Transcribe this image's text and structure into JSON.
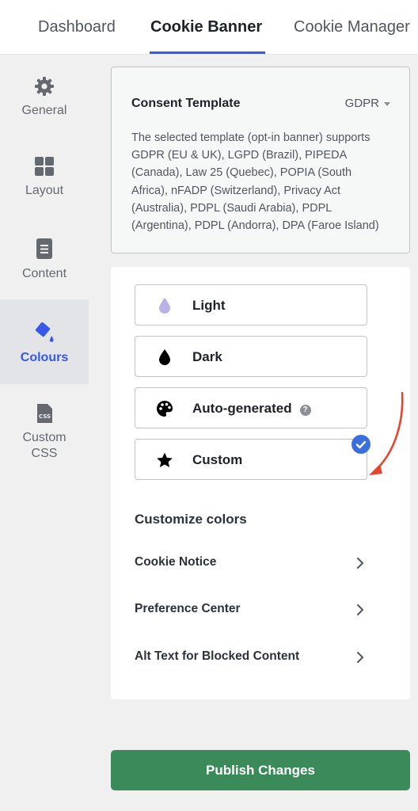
{
  "tabs": [
    {
      "label": "Dashboard",
      "active": false
    },
    {
      "label": "Cookie Banner",
      "active": true
    },
    {
      "label": "Cookie Manager",
      "active": false
    }
  ],
  "sidebar": {
    "items": [
      {
        "label": "General",
        "icon": "gear-icon",
        "active": false
      },
      {
        "label": "Layout",
        "icon": "grid-icon",
        "active": false
      },
      {
        "label": "Content",
        "icon": "document-icon",
        "active": false
      },
      {
        "label": "Colours",
        "icon": "paint-bucket-icon",
        "active": true
      },
      {
        "label": "Custom CSS",
        "icon": "css-file-icon",
        "active": false
      }
    ]
  },
  "consent_template": {
    "title": "Consent Template",
    "selected": "GDPR",
    "description": "The selected template (opt-in banner) supports GDPR (EU & UK), LGPD (Brazil), PIPEDA (Canada), Law 25 (Quebec), POPIA (South Africa), nFADP (Switzerland), Privacy Act (Australia), PDPL (Saudi Arabia), PDPL (Argentina), PDPL (Andorra), DPA (Faroe Island)"
  },
  "colour_options": [
    {
      "label": "Light",
      "icon": "drop-light-icon",
      "selected": false
    },
    {
      "label": "Dark",
      "icon": "drop-dark-icon",
      "selected": false
    },
    {
      "label": "Auto-generated",
      "icon": "palette-icon",
      "selected": false,
      "has_help": true
    },
    {
      "label": "Custom",
      "icon": "star-icon",
      "selected": true
    }
  ],
  "customize": {
    "title": "Customize colors",
    "rows": [
      {
        "label": "Cookie Notice"
      },
      {
        "label": "Preference Center"
      },
      {
        "label": "Alt Text for Blocked Content"
      }
    ]
  },
  "publish_label": "Publish Changes",
  "colors": {
    "accent": "#3858e9",
    "publish": "#3a8a5a",
    "annotation_arrow": "#e8442e",
    "check_badge": "#3b6fe0"
  }
}
